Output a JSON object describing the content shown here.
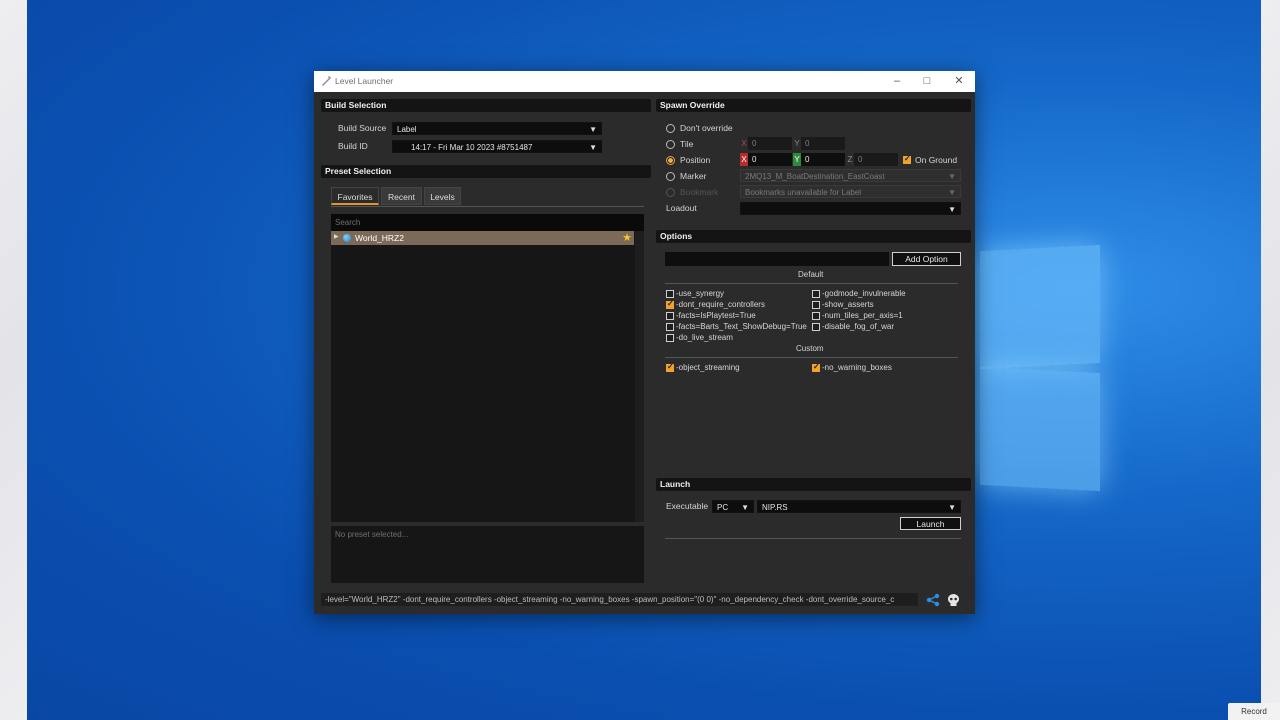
{
  "window": {
    "title": "Level Launcher"
  },
  "build_selection": {
    "header": "Build Selection",
    "build_source_label": "Build Source",
    "build_source_value": "Label",
    "build_id_label": "Build ID",
    "build_id_value": "14:17 - Fri Mar 10 2023 #8751487"
  },
  "preset_selection": {
    "header": "Preset Selection",
    "tabs": [
      "Favorites",
      "Recent",
      "Levels"
    ],
    "search_placeholder": "Search",
    "items": [
      {
        "label": "World_HRZ2",
        "favorite": true
      }
    ],
    "details_placeholder": "No preset selected..."
  },
  "spawn_override": {
    "header": "Spawn Override",
    "dont_override": "Don't override",
    "tile": {
      "label": "Tile",
      "x": "0",
      "y": "0"
    },
    "position": {
      "label": "Position",
      "x": "0",
      "y": "0",
      "z": "0",
      "on_ground": "On Ground"
    },
    "marker": {
      "label": "Marker",
      "value": "2MQ13_M_BoatDestination_EastCoast"
    },
    "bookmark": {
      "label": "Bookmark",
      "value": "Bookmarks unavailable for Label"
    },
    "loadout": {
      "label": "Loadout",
      "value": ""
    },
    "axes": {
      "x": "X",
      "y": "Y",
      "z": "Z"
    }
  },
  "options": {
    "header": "Options",
    "add_option": "Add Option",
    "default_label": "Default",
    "custom_label": "Custom",
    "default_left": [
      {
        "label": "-use_synergy",
        "checked": false
      },
      {
        "label": "-dont_require_controllers",
        "checked": true
      },
      {
        "label": "-facts=IsPlaytest=True",
        "checked": false
      },
      {
        "label": "-facts=Barts_Text_ShowDebug=True",
        "checked": false
      },
      {
        "label": "-do_live_stream",
        "checked": false
      }
    ],
    "default_right": [
      {
        "label": "-godmode_invulnerable",
        "checked": false
      },
      {
        "label": "-show_asserts",
        "checked": false
      },
      {
        "label": "-num_tiles_per_axis=1",
        "checked": false
      },
      {
        "label": "-disable_fog_of_war",
        "checked": false
      }
    ],
    "custom": [
      {
        "label": "-object_streaming",
        "checked": true
      },
      {
        "label": "-no_warning_boxes",
        "checked": true
      }
    ]
  },
  "launch": {
    "header": "Launch",
    "executable_label": "Executable",
    "platform": "PC",
    "executable": "NIP.RS",
    "launch_button": "Launch"
  },
  "command_line": "-level=\"World_HRZ2\" -dont_require_controllers -object_streaming -no_warning_boxes -spawn_position=\"(0 0)\" -no_dependency_check -dont_override_source_c",
  "taskbar": {
    "record": "Record"
  },
  "colors": {
    "accent": "#f0a22b",
    "window_bg": "#2b2b2b",
    "desktop": "#0a4fb0"
  }
}
